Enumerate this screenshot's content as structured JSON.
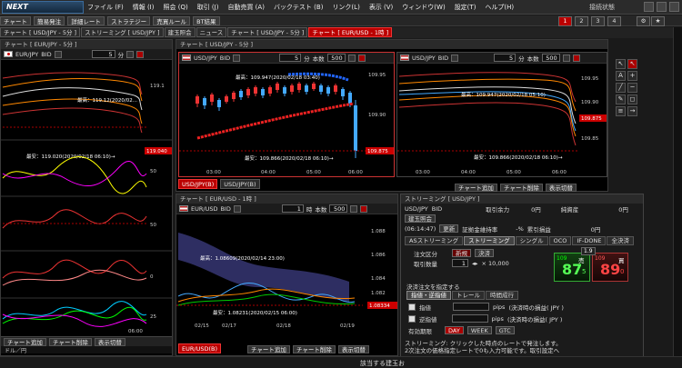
{
  "app": {
    "logo": "NEXT",
    "menus": [
      "ファイル (F)",
      "情報 (I)",
      "照会 (Q)",
      "取引 (J)",
      "自動売買 (A)",
      "バックテスト (B)",
      "リンク(L)",
      "表示 (V)",
      "ウィンドウ(W)",
      "設定(T)",
      "ヘルプ(H)"
    ],
    "connection": "接続状態",
    "screen_tabs": [
      "1",
      "2",
      "3",
      "4"
    ],
    "screen_active": 0
  },
  "toolbar": [
    "チャート",
    "簡易発注",
    "詳細レート",
    "ストラテジー",
    "売買ルール",
    "BT結果"
  ],
  "panel_tabs": [
    {
      "label": "チャート [ USD/JPY - 5分 ]",
      "red": false
    },
    {
      "label": "ストリーミング [ USD/JPY ]",
      "red": false
    },
    {
      "label": "建玉照会",
      "red": false
    },
    {
      "label": "ニュース",
      "red": false
    },
    {
      "label": "チャート [ USD/JPY - 5分 ]",
      "red": false
    },
    {
      "label": "チャート [ EUR/USD - 1時 ]",
      "red": true
    }
  ],
  "left_chart": {
    "title": "チャート [ EUR/JPY - 5分 ]",
    "pair": "EUR/JPY",
    "bid": "BID",
    "period": "5",
    "unit": "分",
    "price_tag": "119.040",
    "high": "最高：119.12(2020/02...",
    "low": "最安：119.020(2020/02/18 06:10)→",
    "yaxis": [
      "119.1",
      "50",
      "50",
      "0",
      "25"
    ],
    "xaxis": [
      "",
      "",
      "",
      "06:00"
    ],
    "footer": {
      "add": "チャート追加",
      "del": "チャート削除",
      "switch": "表示切替"
    },
    "pair_select": "ドル／円"
  },
  "center_top": {
    "title": "チャート [ USD/JPY - 5分 ]",
    "left": {
      "pair": "USD/JPY",
      "bid": "BID",
      "period": "5",
      "unit": "分",
      "count_label": "本数",
      "count": "500",
      "high": "最高：109.947(2020/02/18 03:40)",
      "low": "最安：109.866(2020/02/18 06:10)→",
      "price_tag": "109.875",
      "yaxis": [
        "109.95",
        "109.90"
      ],
      "xaxis": [
        "03:00",
        "04:00",
        "05:00",
        "06:00"
      ]
    },
    "right": {
      "pair": "USD/JPY",
      "bid": "BID",
      "period": "5",
      "unit": "分",
      "count_label": "本数",
      "count": "500",
      "high": "最高：109.947(2020/02/18 05:10)",
      "low": "最安：109.866(2020/02/18 06:10)→",
      "price_tag": "109.875",
      "yaxis": [
        "109.95",
        "109.90",
        "109.85"
      ],
      "xaxis": [
        "03:00",
        "04:00",
        "05:00",
        "06:00"
      ]
    },
    "tabs": [
      "USD/JPY(B)",
      "USD/JPY(B)"
    ],
    "footer": {
      "add": "チャート追加",
      "del": "チャート削除",
      "switch": "表示切替"
    }
  },
  "center_bottom": {
    "title": "チャート [ EUR/USD - 1時 ]",
    "pair": "EUR/USD",
    "bid": "BID",
    "period": "1",
    "unit": "時",
    "count_label": "本数",
    "count": "500",
    "high": "最高：1.08609(2020/02/14 23:00)",
    "low": "最安：1.08231(2020/02/15 06:00)",
    "price_tag": "1.08334",
    "yaxis": [
      "1.088",
      "1.086",
      "1.084",
      "1.082"
    ],
    "xaxis": [
      "02/15",
      "02/17",
      "02/18",
      "02/19"
    ],
    "tab": "EUR/USD(B)",
    "footer": {
      "add": "チャート追加",
      "del": "チャート削除",
      "switch": "表示切替"
    }
  },
  "order": {
    "title": "ストリーミング [ USD/JPY ]",
    "pair": "USD/JPY",
    "mode": "BID",
    "rows": [
      {
        "a": "取引余力",
        "b": "0円",
        "c": "純資産",
        "d": "0円"
      },
      {
        "a": "証拠金維持率",
        "b": "-%",
        "c": "累引損益",
        "d": "0円"
      }
    ],
    "time": "(06:14:47)",
    "update": "更新",
    "position": "建玉照会",
    "tabs": [
      "ASストリーミング",
      "ストリーミング",
      "シングル",
      "OCO",
      "IF-DONE",
      "全決済"
    ],
    "order_type_label": "注文区分",
    "new": "新規",
    "close": "決済",
    "qty_label": "取引数量",
    "qty": "1",
    "qty_unit": "× 10,000",
    "sell_label": "売",
    "buy_label": "買",
    "sell_big": "109",
    "sell_main": "87",
    "sell_pip": "5",
    "buy_big": "109",
    "buy_main": "89",
    "buy_pip": "0",
    "spread": "1.9",
    "condition_head": "決済注文を指定する",
    "cond_tabs": [
      "指値・逆指値",
      "トレール",
      "時間成行"
    ],
    "limit_label": "指値",
    "stop_label": "逆指値",
    "pips": "pips",
    "limit_note": "(決済時の損益( JPY )",
    "stop_note": "(決済時の損益( JPY )",
    "expire_label": "有効期限",
    "expire_opts": [
      "DAY",
      "WEEK",
      "GTC"
    ],
    "status_line1": "ストリーミング: クリックした時点のレートで発注します。",
    "status_line2": "2次注文の価格指定レートで0も入力可能です。取引設定へ"
  },
  "status": {
    "left": "該当する建玉お"
  }
}
